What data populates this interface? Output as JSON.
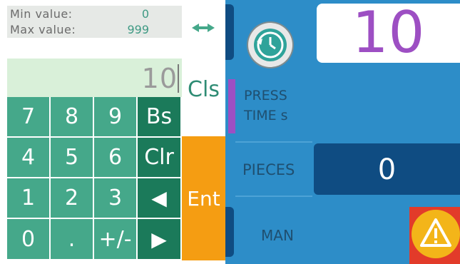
{
  "range": {
    "min_label": "Min value:",
    "min_value": "0",
    "max_label": "Max value:",
    "max_value": "999"
  },
  "display": {
    "value": "10"
  },
  "keypad": {
    "keys": [
      "7",
      "8",
      "9",
      "Bs",
      "4",
      "5",
      "6",
      "Clr",
      "1",
      "2",
      "3",
      "◀",
      "0",
      ".",
      "+/-",
      "▶"
    ]
  },
  "side": {
    "cls_label": "Cls",
    "ent_label": "Ent"
  },
  "machine": {
    "timer_value": "10",
    "press_time_label": [
      "PRESS",
      "TIME s"
    ],
    "pieces_label": "PIECES",
    "pieces_value": "0",
    "mode_label": "MAN"
  },
  "colors": {
    "accent_purple": "#9d4fc3",
    "panel_blue": "#2d8dc8",
    "key_green": "#45a88a",
    "ent_orange": "#f59d12",
    "alarm_red": "#e23b2a"
  },
  "icons": [
    "left-right-arrows-icon",
    "history-clock-icon",
    "warning-icon"
  ]
}
